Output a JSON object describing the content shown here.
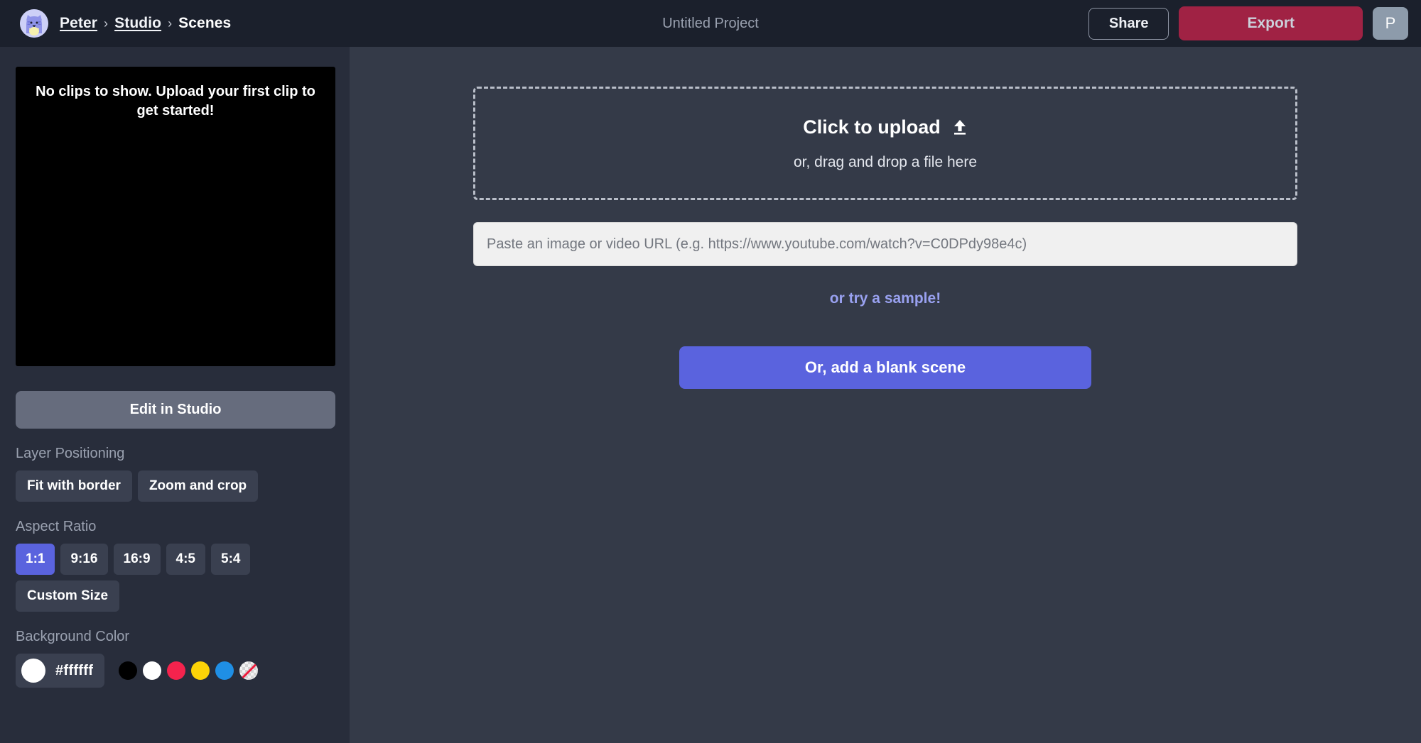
{
  "header": {
    "avatar_icon": "cat-avatar-icon",
    "breadcrumb": {
      "user": "Peter",
      "section": "Studio",
      "current": "Scenes",
      "separator": "›"
    },
    "project_title": "Untitled Project",
    "share_label": "Share",
    "export_label": "Export",
    "profile_initial": "P"
  },
  "sidebar": {
    "clip_empty_message": "No clips to show. Upload your first clip to get started!",
    "edit_in_studio_label": "Edit in Studio",
    "layer_positioning": {
      "label": "Layer Positioning",
      "options": [
        {
          "label": "Fit with border",
          "selected": false
        },
        {
          "label": "Zoom and crop",
          "selected": false
        }
      ]
    },
    "aspect_ratio": {
      "label": "Aspect Ratio",
      "options": [
        {
          "label": "1:1",
          "selected": true
        },
        {
          "label": "9:16",
          "selected": false
        },
        {
          "label": "16:9",
          "selected": false
        },
        {
          "label": "4:5",
          "selected": false
        },
        {
          "label": "5:4",
          "selected": false
        }
      ],
      "custom_label": "Custom Size"
    },
    "background_color": {
      "label": "Background Color",
      "current_hex": "#ffffff",
      "swatches": [
        {
          "name": "black",
          "hex": "#000000"
        },
        {
          "name": "white",
          "hex": "#ffffff"
        },
        {
          "name": "red",
          "hex": "#f4234d"
        },
        {
          "name": "yellow",
          "hex": "#fcd307"
        },
        {
          "name": "blue",
          "hex": "#1f8fe5"
        },
        {
          "name": "transparent",
          "hex": "transparent"
        }
      ]
    }
  },
  "main": {
    "dropzone": {
      "title": "Click to upload",
      "upload_icon": "upload-arrow-icon",
      "subtitle": "or, drag and drop a file here"
    },
    "url_input_placeholder": "Paste an image or video URL (e.g. https://www.youtube.com/watch?v=C0DPdy98e4c)",
    "url_input_value": "",
    "sample_link_label": "or try a sample!",
    "blank_scene_label": "Or, add a blank scene"
  },
  "colors": {
    "accent": "#5a63de",
    "export": "#a02244",
    "header_bg": "#1b202c",
    "sidebar_bg": "#282d3b",
    "main_bg": "#343a48"
  }
}
